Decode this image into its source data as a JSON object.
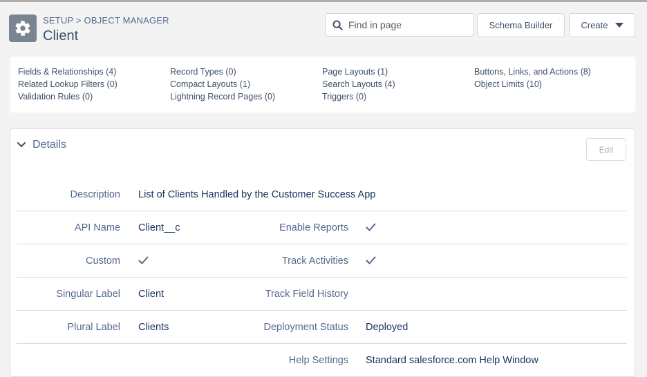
{
  "header": {
    "breadcrumb": "SETUP > OBJECT MANAGER",
    "title": "Client",
    "search_placeholder": "Find in page",
    "schema_builder_label": "Schema Builder",
    "create_label": "Create"
  },
  "quick_links": {
    "col1": [
      "Fields & Relationships (4)",
      "Related Lookup Filters (0)",
      "Validation Rules (0)"
    ],
    "col2": [
      "Record Types (0)",
      "Compact Layouts (1)",
      "Lightning Record Pages (0)"
    ],
    "col3": [
      "Page Layouts (1)",
      "Search Layouts (4)",
      "Triggers (0)"
    ],
    "col4": [
      "Buttons, Links, and Actions (8)",
      "Object Limits (10)"
    ]
  },
  "details": {
    "section_title": "Details",
    "edit_label": "Edit",
    "description_label": "Description",
    "description_value": "List of Clients Handled by the Customer Success App",
    "api_name_label": "API Name",
    "api_name_value": "Client__c",
    "enable_reports_label": "Enable Reports",
    "enable_reports_checked": true,
    "custom_label": "Custom",
    "custom_checked": true,
    "track_activities_label": "Track Activities",
    "track_activities_checked": true,
    "singular_label_label": "Singular Label",
    "singular_label_value": "Client",
    "track_field_history_label": "Track Field History",
    "plural_label_label": "Plural Label",
    "plural_label_value": "Clients",
    "deployment_status_label": "Deployment Status",
    "deployment_status_value": "Deployed",
    "help_settings_label": "Help Settings",
    "help_settings_value": "Standard salesforce.com Help Window"
  },
  "colors": {
    "object_icon_bg": "#7b8592",
    "label_text": "#54698d",
    "value_text": "#16325c",
    "page_bg": "#f3f3f4"
  },
  "icons": {
    "object": "gear-icon",
    "search": "search-icon",
    "create_caret": "caret-down-icon",
    "section_toggle": "chevron-down-icon",
    "checked": "checkmark-icon"
  }
}
